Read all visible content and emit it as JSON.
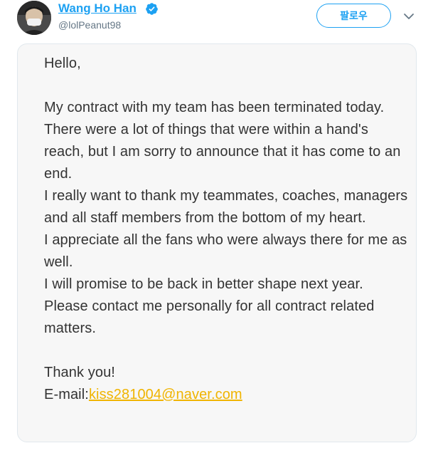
{
  "author": {
    "display_name": "Wang Ho Han",
    "handle": "@lolPeanut98",
    "verified_icon": "verified-badge-icon"
  },
  "actions": {
    "follow_label": "팔로우",
    "menu_icon": "chevron-down-icon"
  },
  "colors": {
    "accent": "#1da1f2",
    "link_yellow": "#f0b400",
    "text": "#333333",
    "card_bg": "#f7f7f7"
  },
  "letter": {
    "greeting": "Hello,",
    "paragraph_1": "My contract with my team has been terminated today.",
    "paragraph_2": "There were a lot of things that were within a hand's reach, but I am sorry to announce that it has come to an end.",
    "paragraph_3": "I really want to thank my teammates, coaches, managers and all staff members from the bottom of my heart.",
    "paragraph_4": "I appreciate all the fans who were always there for me as well.",
    "paragraph_5": "I will promise to be back in better shape next year.",
    "paragraph_6": "Please contact me personally for all contract related matters.",
    "closing": "Thank you!",
    "email_label": "E-mail:",
    "email_address": "kiss281004@naver.com"
  }
}
